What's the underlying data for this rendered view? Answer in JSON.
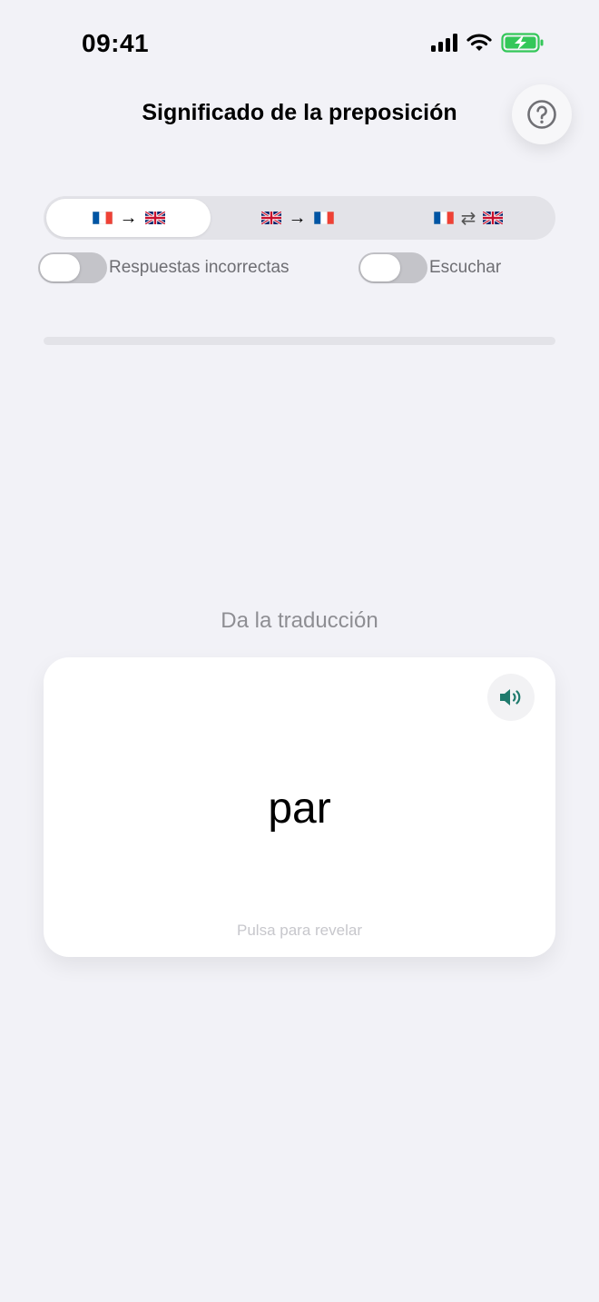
{
  "status_bar": {
    "time": "09:41",
    "icons": [
      "cellular-signal-icon",
      "wifi-icon",
      "battery-charging-icon"
    ],
    "battery_color": "#34c759"
  },
  "header": {
    "title": "Significado de la preposición",
    "help_icon": "question-mark-icon"
  },
  "direction_selector": {
    "selected_index": 0,
    "options": [
      {
        "from": "french-flag-icon",
        "arrow": "→",
        "to": "uk-flag-icon"
      },
      {
        "from": "uk-flag-icon",
        "arrow": "→",
        "to": "french-flag-icon"
      },
      {
        "from": "french-flag-icon",
        "arrow": "⇄",
        "to": "uk-flag-icon"
      }
    ]
  },
  "toggles": {
    "wrong_answers": {
      "label": "Respuestas incorrectas",
      "on": false
    },
    "listen": {
      "label": "Escuchar",
      "on": false
    }
  },
  "progress": {
    "fraction": 0
  },
  "quiz": {
    "prompt": "Da la traducción",
    "word": "par",
    "hint": "Pulsa para revelar",
    "speaker_icon": "speaker-icon",
    "accent_color": "#1f7a6d"
  }
}
